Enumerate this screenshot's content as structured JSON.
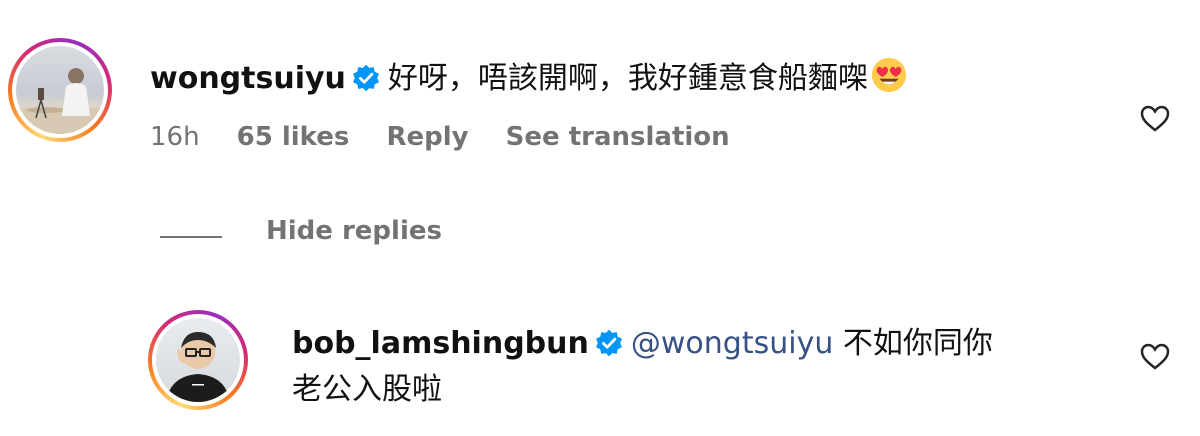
{
  "comment": {
    "username": "wongtsuiyu",
    "text": "好呀，唔該開啊，我好鍾意食船麵㗎",
    "emoji": "smiling-face-with-heart-eyes",
    "time": "16h",
    "likes": "65 likes",
    "reply_label": "Reply",
    "translate_label": "See translation"
  },
  "replies_toggle": {
    "label": "Hide replies"
  },
  "reply": {
    "username": "bob_lamshingbun",
    "mention": "@wongtsuiyu",
    "text_line1": "不如你同你",
    "text_line2": "老公入股啦"
  },
  "colors": {
    "verified": "#0095f6",
    "meta": "#737373",
    "mention": "#385185"
  }
}
